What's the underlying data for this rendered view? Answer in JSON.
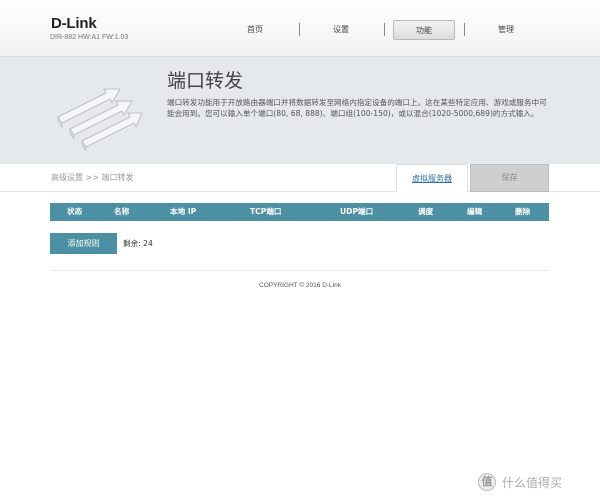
{
  "brand": {
    "logo": "D-Link",
    "model_info": "DIR-882 HW:A1 FW:1.03"
  },
  "nav": {
    "items": [
      {
        "label": "首页"
      },
      {
        "label": "设置"
      },
      {
        "label": "功能"
      },
      {
        "label": "管理"
      }
    ],
    "active": "功能"
  },
  "banner": {
    "title": "端口转发",
    "description": "端口转发功能用于开放路由器端口并将数据转发至网络内指定设备的端口上。这在某些特定应用、游戏或服务中可能会用到。您可以输入单个端口(80, 68, 888)、端口组(100-150)，或以混合(1020-5000,689)的方式输入。"
  },
  "breadcrumb": "高级设置 >> 端口转发",
  "buttons": {
    "virtual_server": "虚拟服务器",
    "save": "保存",
    "add_rule": "添加规则"
  },
  "table": {
    "columns": [
      "状态",
      "名称",
      "本地 IP",
      "TCP端口",
      "UDP端口",
      "调度",
      "编辑",
      "删除"
    ]
  },
  "remaining": "剩余: 24",
  "footer": {
    "copyright": "COPYRIGHT © 2016 D-Link"
  },
  "watermark": {
    "symbol": "值",
    "text": "什么值得买"
  },
  "colors": {
    "accent": "#4c91a3",
    "banner_bg": "#e5e9ec",
    "save_disabled": "#cfcfcf"
  }
}
